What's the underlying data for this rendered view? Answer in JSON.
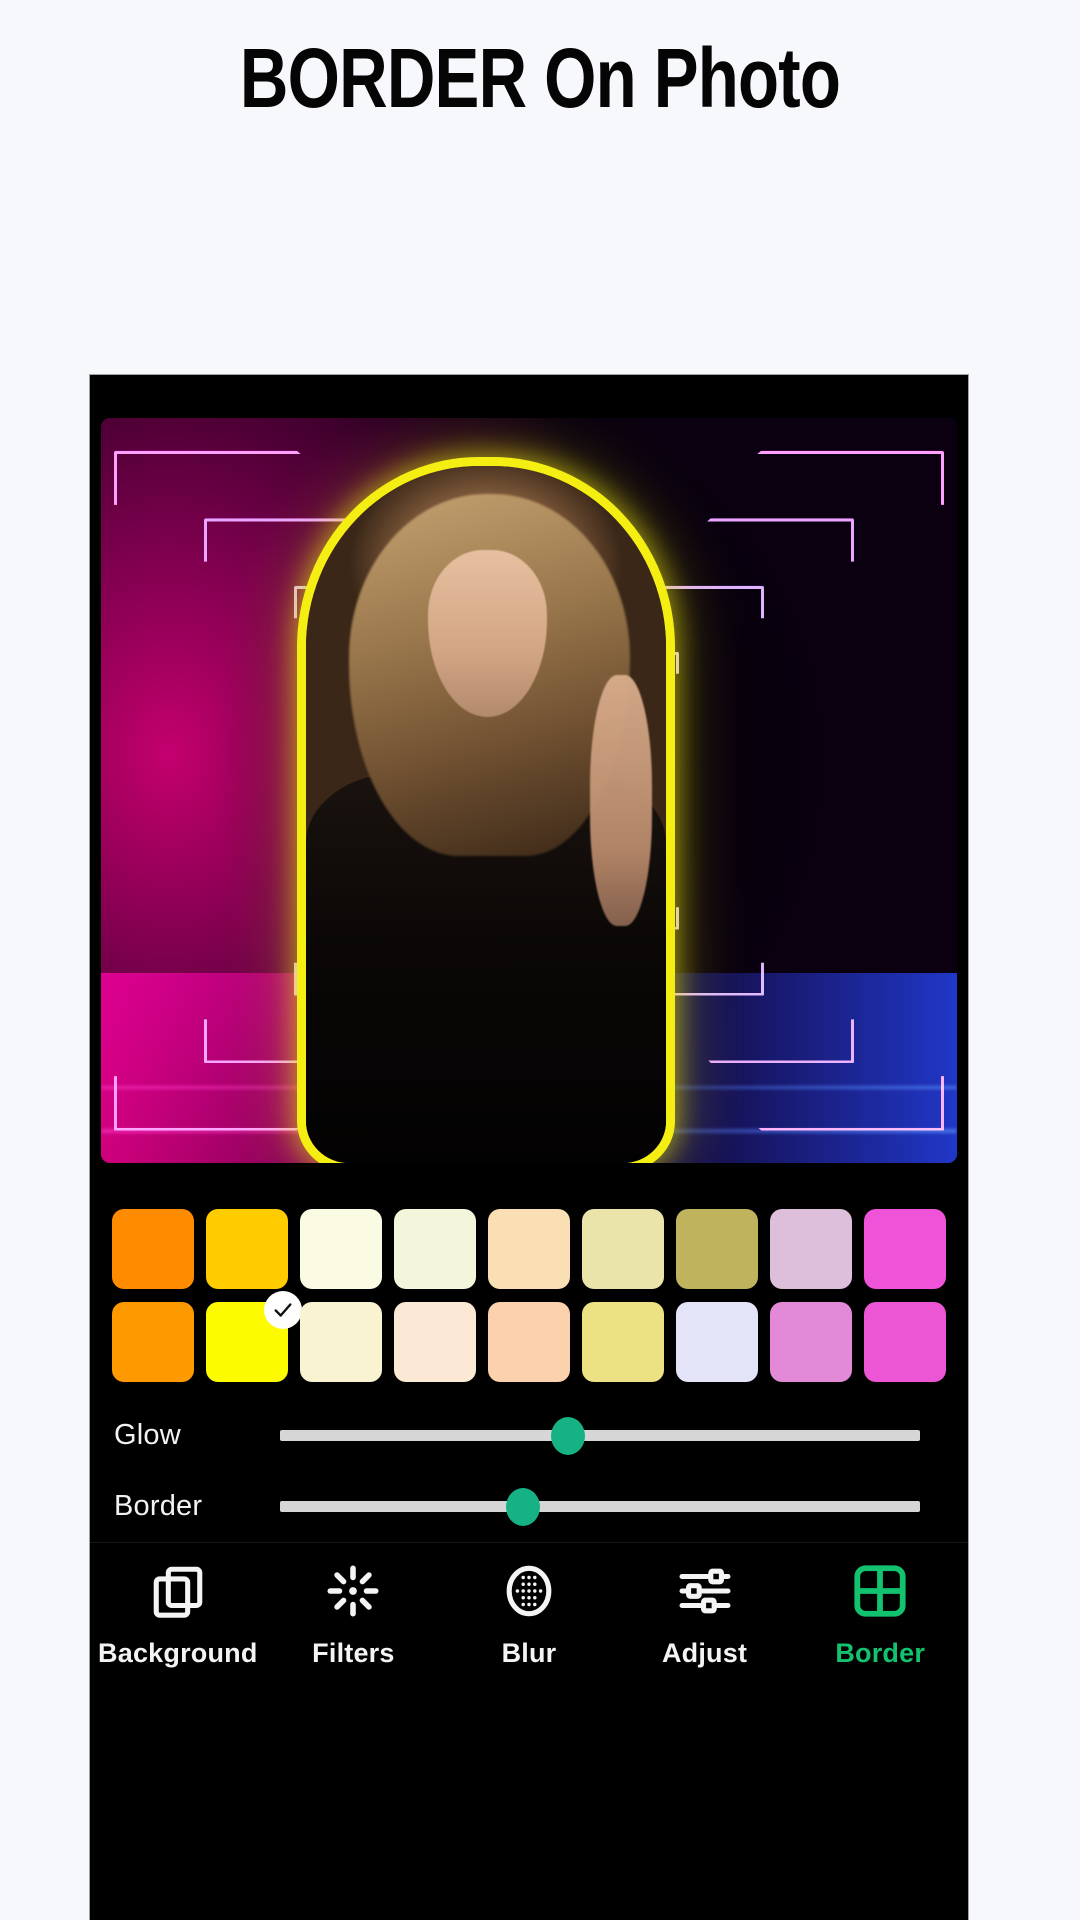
{
  "page": {
    "background_color": "#f7f8fc",
    "headline": "BORDER On Photo"
  },
  "app": {
    "frame_background": "#000000",
    "accent_color": "#12c26e",
    "slider_thumb_color": "#16b286",
    "selected_border_color": "#f4ee12"
  },
  "photo": {
    "description": "Woman with blonde hair in black sheer top, neon magenta and blue chevron backdrop, yellow neon outline applied to subject",
    "outline_color": "#f4ee12"
  },
  "palette": {
    "selected_index": 1,
    "selected_row": 2,
    "check_icon": "check-icon",
    "rows": [
      {
        "name": "palette-row-1",
        "colors": [
          "#ff8c00",
          "#ffcc00",
          "#fbfbe3",
          "#f4f6dc",
          "#fadfb4",
          "#eae4ab",
          "#bfb35e",
          "#ddbfdb",
          "#ef54d8"
        ]
      },
      {
        "name": "palette-row-2",
        "colors": [
          "#ff9900",
          "#fdfb00",
          "#faf3d2",
          "#fbe9d6",
          "#fbd1ae",
          "#ece283",
          "#e4e4f8",
          "#e28ad7",
          "#ec56d4"
        ]
      }
    ]
  },
  "sliders": [
    {
      "label": "Glow",
      "value_percent": 45,
      "track_color": "#d6d6d6",
      "thumb_color": "#16b286"
    },
    {
      "label": "Border",
      "value_percent": 38,
      "track_color": "#d6d6d6",
      "thumb_color": "#16b286"
    }
  ],
  "toolbar": {
    "active_tab": "Border",
    "items": [
      {
        "label": "Background",
        "icon": "layers-icon",
        "active": false
      },
      {
        "label": "Filters",
        "icon": "sparkle-icon",
        "active": false
      },
      {
        "label": "Blur",
        "icon": "blur-dots-icon",
        "active": false
      },
      {
        "label": "Adjust",
        "icon": "sliders-icon",
        "active": false
      },
      {
        "label": "Border",
        "icon": "grid-four-icon",
        "active": true
      }
    ]
  }
}
